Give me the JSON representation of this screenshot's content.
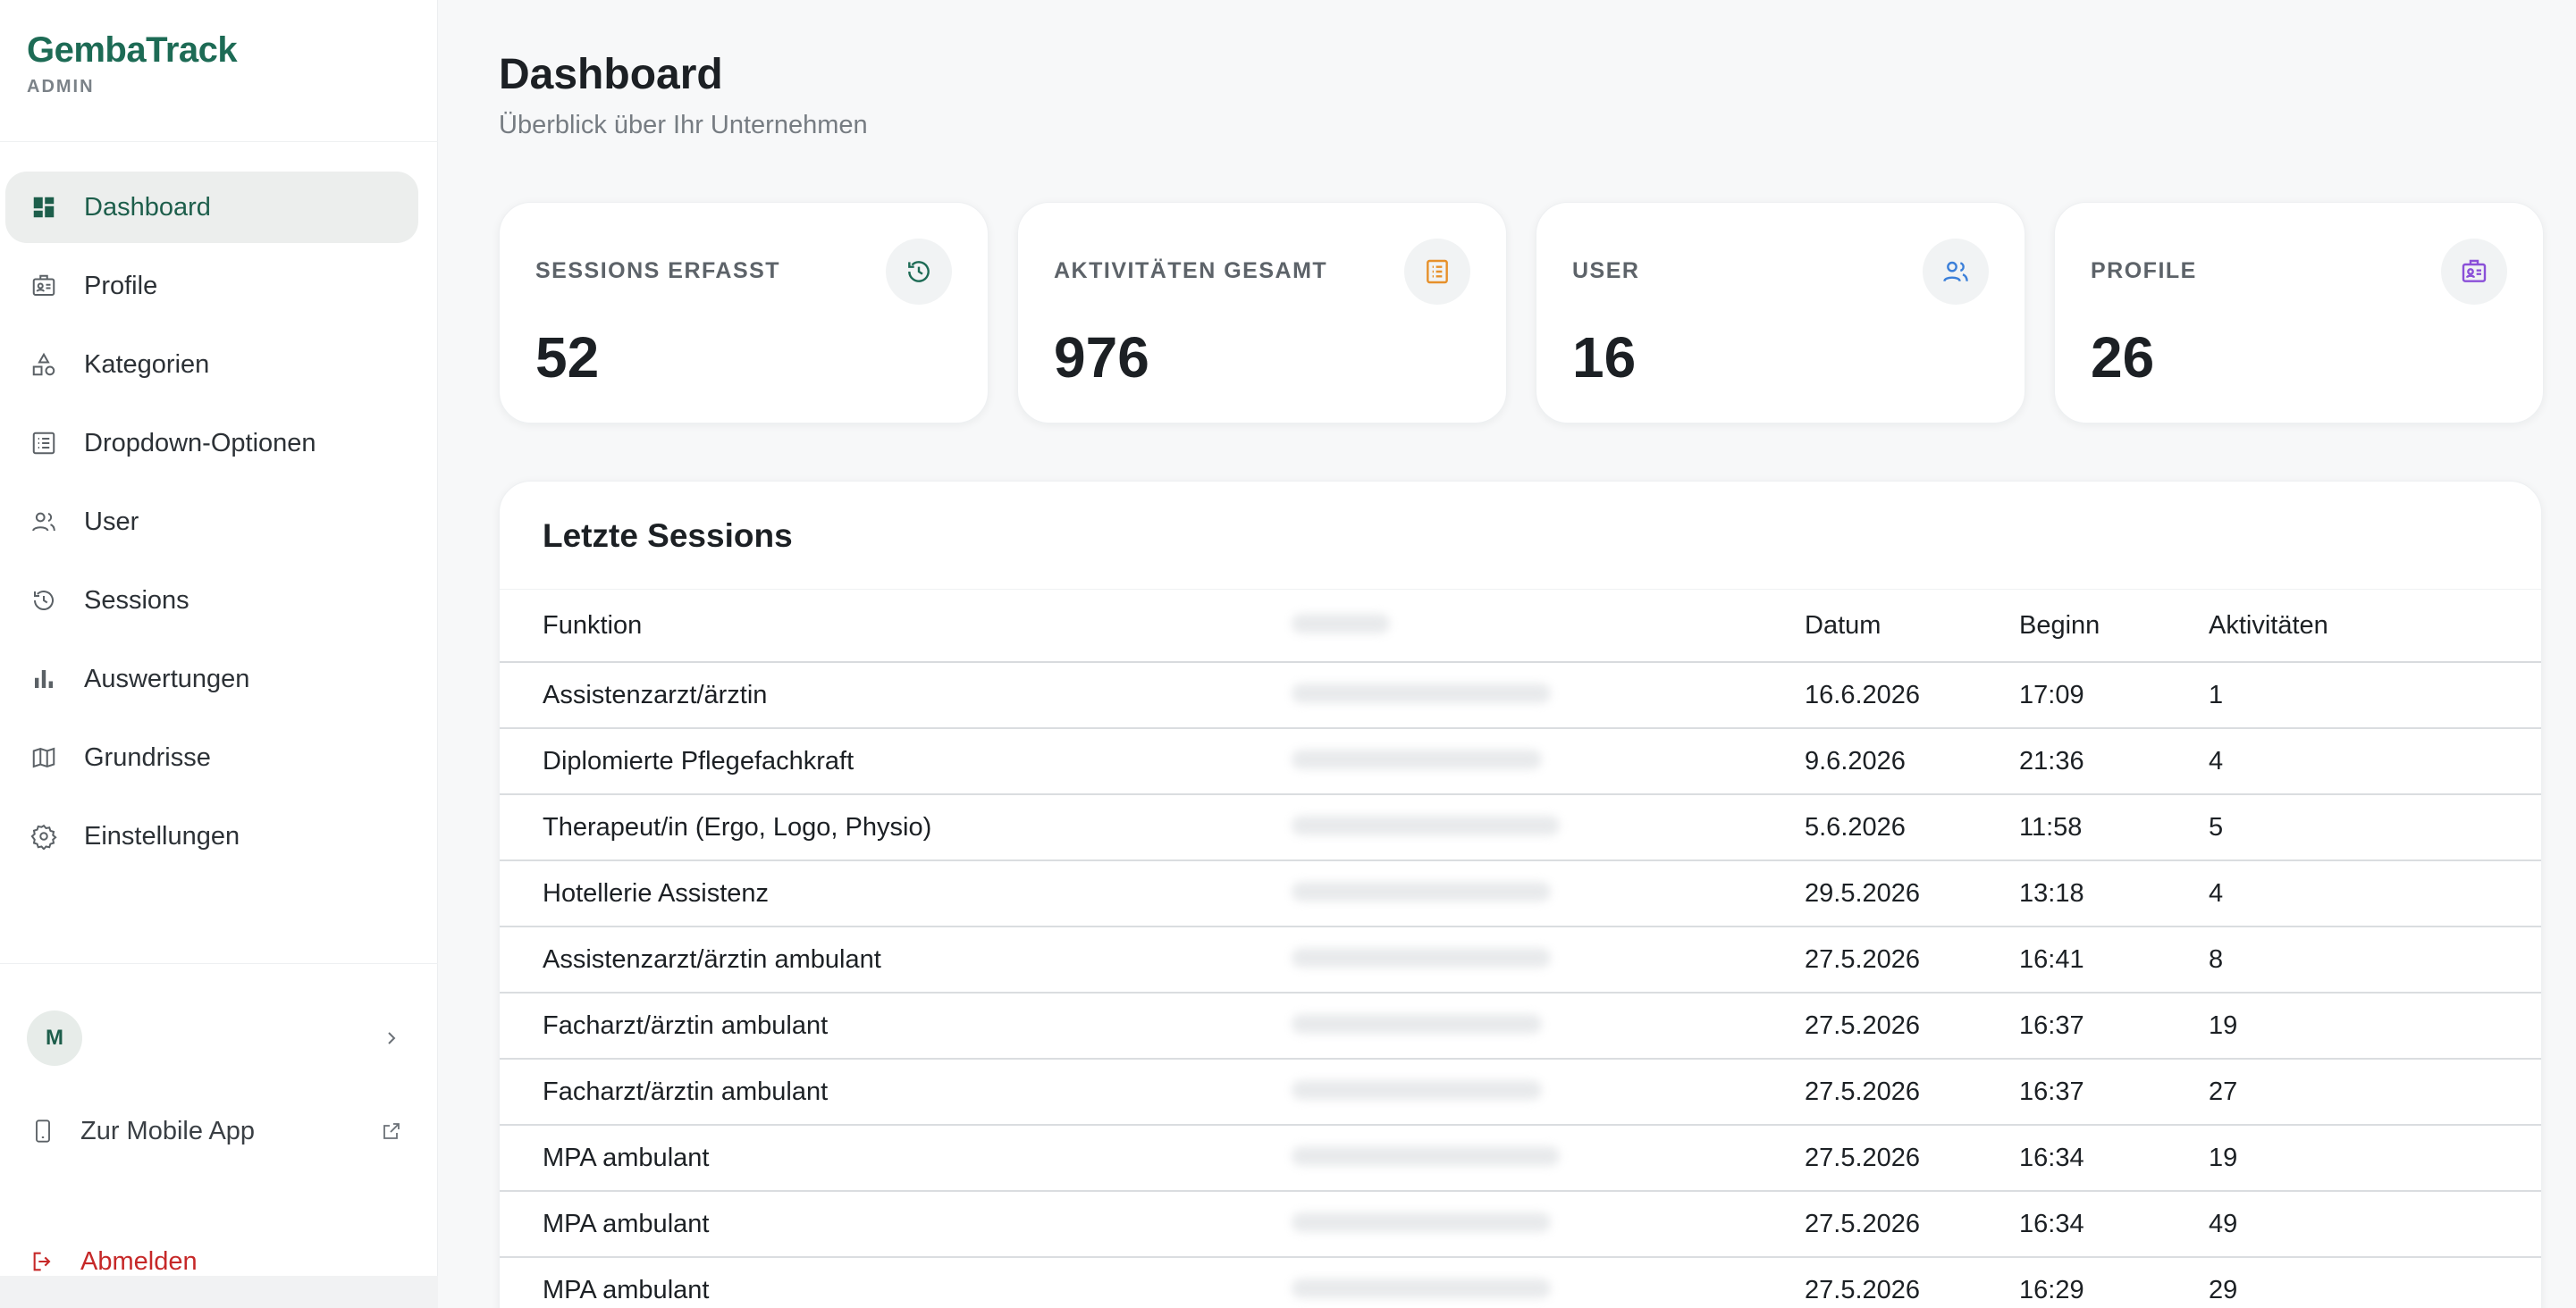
{
  "brand": {
    "name": "GembaTrack",
    "subtitle": "ADMIN"
  },
  "sidebar": {
    "items": [
      {
        "label": "Dashboard",
        "icon": "dashboard-icon",
        "active": true
      },
      {
        "label": "Profile",
        "icon": "id-card-icon",
        "active": false
      },
      {
        "label": "Kategorien",
        "icon": "shapes-icon",
        "active": false
      },
      {
        "label": "Dropdown-Optionen",
        "icon": "list-icon",
        "active": false
      },
      {
        "label": "User",
        "icon": "users-icon",
        "active": false
      },
      {
        "label": "Sessions",
        "icon": "history-icon",
        "active": false
      },
      {
        "label": "Auswertungen",
        "icon": "bar-chart-icon",
        "active": false
      },
      {
        "label": "Grundrisse",
        "icon": "map-icon",
        "active": false
      },
      {
        "label": "Einstellungen",
        "icon": "gear-icon",
        "active": false
      }
    ],
    "user_initial": "M",
    "mobile_app_label": "Zur Mobile App",
    "logout_label": "Abmelden"
  },
  "page": {
    "title": "Dashboard",
    "subtitle": "Überblick über Ihr Unternehmen"
  },
  "stats": [
    {
      "label": "SESSIONS ERFASST",
      "value": "52",
      "icon": "history-icon",
      "color": "#1d6b55"
    },
    {
      "label": "AKTIVITÄTEN GESAMT",
      "value": "976",
      "icon": "list-icon",
      "color": "#e6902a"
    },
    {
      "label": "USER",
      "value": "16",
      "icon": "users-icon",
      "color": "#3b7fd9"
    },
    {
      "label": "PROFILE",
      "value": "26",
      "icon": "id-card-icon",
      "color": "#8a4fd8"
    }
  ],
  "sessions": {
    "title": "Letzte Sessions",
    "columns": {
      "funktion": "Funktion",
      "datum": "Datum",
      "beginn": "Beginn",
      "aktivitaeten": "Aktivitäten"
    },
    "rows": [
      {
        "funktion": "Assistenzarzt/ärztin",
        "datum": "16.6.2026",
        "beginn": "17:09",
        "aktivitaeten": "1"
      },
      {
        "funktion": "Diplomierte Pflegefachkraft",
        "datum": "9.6.2026",
        "beginn": "21:36",
        "aktivitaeten": "4"
      },
      {
        "funktion": "Therapeut/in (Ergo, Logo, Physio)",
        "datum": "5.6.2026",
        "beginn": "11:58",
        "aktivitaeten": "5"
      },
      {
        "funktion": "Hotellerie Assistenz",
        "datum": "29.5.2026",
        "beginn": "13:18",
        "aktivitaeten": "4"
      },
      {
        "funktion": "Assistenzarzt/ärztin ambulant",
        "datum": "27.5.2026",
        "beginn": "16:41",
        "aktivitaeten": "8"
      },
      {
        "funktion": "Facharzt/ärztin ambulant",
        "datum": "27.5.2026",
        "beginn": "16:37",
        "aktivitaeten": "19"
      },
      {
        "funktion": "Facharzt/ärztin ambulant",
        "datum": "27.5.2026",
        "beginn": "16:37",
        "aktivitaeten": "27"
      },
      {
        "funktion": "MPA ambulant",
        "datum": "27.5.2026",
        "beginn": "16:34",
        "aktivitaeten": "19"
      },
      {
        "funktion": "MPA ambulant",
        "datum": "27.5.2026",
        "beginn": "16:34",
        "aktivitaeten": "49"
      },
      {
        "funktion": "MPA ambulant",
        "datum": "27.5.2026",
        "beginn": "16:29",
        "aktivitaeten": "29"
      }
    ]
  }
}
